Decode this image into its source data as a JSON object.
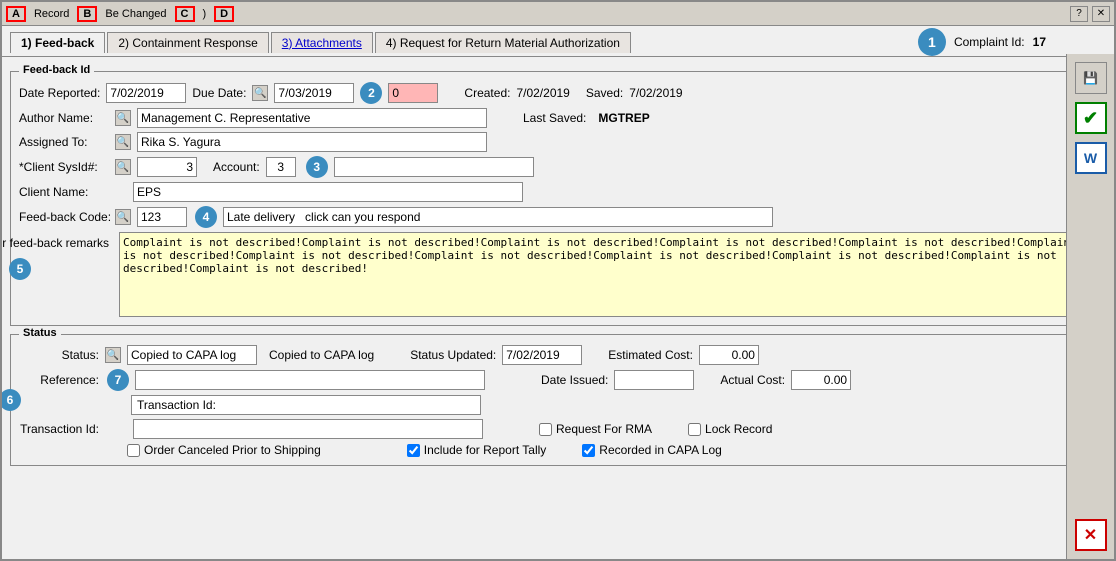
{
  "window": {
    "title": "Record",
    "subtitle": "Be Changed",
    "labels": {
      "A": "A",
      "B": "B",
      "C": "C",
      "D": "D"
    }
  },
  "tabs": [
    {
      "id": "feedback",
      "label": "1) Feed-back",
      "underline": "F",
      "active": true
    },
    {
      "id": "containment",
      "label": "2) Containment Response",
      "underline": "C",
      "active": false
    },
    {
      "id": "attachments",
      "label": "3) Attachments",
      "underline": "A",
      "active": false
    },
    {
      "id": "rma",
      "label": "4) Request for Return Material Authorization",
      "underline": "R",
      "active": false
    }
  ],
  "complaint_id_label": "Complaint Id:",
  "complaint_id_value": "17",
  "badge1": "1",
  "badge2": "2",
  "badge3": "3",
  "badge4": "4",
  "badge5": "5",
  "badge6": "6",
  "badge7": "7",
  "feedback_section": {
    "title": "Feed-back Id",
    "date_reported_label": "Date Reported:",
    "date_reported_value": "7/02/2019",
    "due_date_label": "Due Date:",
    "due_date_value": "7/03/2019",
    "pink_field_value": "0",
    "created_label": "Created:",
    "created_value": "7/02/2019",
    "saved_label": "Saved:",
    "saved_value": "7/02/2019",
    "author_label": "Author Name:",
    "author_value": "Management C. Representative",
    "last_saved_label": "Last Saved:",
    "last_saved_value": "MGTREP",
    "assigned_label": "Assigned To:",
    "assigned_value": "Rika S. Yagura",
    "client_sysid_label": "*Client SysId#:",
    "client_sysid_value": "3",
    "account_label": "Account:",
    "account_value": "3",
    "client_name_label": "Client Name:",
    "client_name_value": "EPS",
    "feedback_code_label": "Feed-back Code:",
    "feedback_code_value": "123",
    "feedback_code_desc": "Late delivery   click can you respond",
    "customer_remarks_label": "Customer feed-back remarks",
    "customer_remarks_value": "Complaint is not described!Complaint is not described!Complaint is not described!Complaint is not described!Complaint is not described!Complaint is not described!Complaint is not described!Complaint is not described!Complaint is not described!Complaint is not described!Complaint is not described!Complaint is not described!"
  },
  "status_section": {
    "title": "Status",
    "status_label": "Status:",
    "status_value": "Copied to CAPA log",
    "status_desc": "Copied to CAPA log",
    "reference_label": "Reference:",
    "reference_value": "",
    "transaction_label": "Transaction Id:",
    "transaction_value": "",
    "status_updated_label": "Status Updated:",
    "status_updated_value": "7/02/2019",
    "date_issued_label": "Date Issued:",
    "date_issued_value": "",
    "estimated_cost_label": "Estimated Cost:",
    "estimated_cost_value": "0.00",
    "actual_cost_label": "Actual Cost:",
    "actual_cost_value": "0.00",
    "order_canceled_label": "Order Canceled Prior to Shipping",
    "order_canceled_checked": false,
    "include_report_label": "Include for Report Tally",
    "include_report_checked": true,
    "request_rma_label": "Request For RMA",
    "request_rma_checked": false,
    "recorded_capa_label": "Recorded in CAPA Log",
    "recorded_capa_checked": true,
    "lock_record_label": "Lock Record",
    "lock_record_checked": false
  },
  "icons": {
    "search": "🔍",
    "save": "💾",
    "check": "✔",
    "word": "W",
    "close": "✕",
    "question": "?"
  }
}
